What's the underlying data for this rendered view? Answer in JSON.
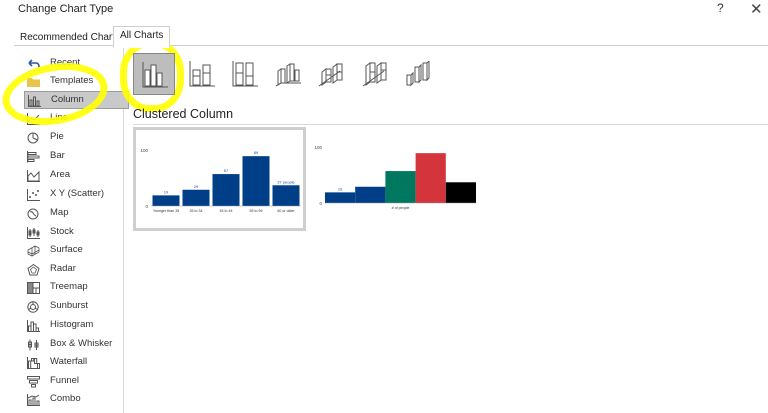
{
  "window": {
    "title": "Change Chart Type",
    "help_label": "?",
    "close_label": "✕"
  },
  "tabs": [
    {
      "label": "Recommended Charts",
      "selected": false
    },
    {
      "label": "All Charts",
      "selected": true
    }
  ],
  "sidebar": {
    "items": [
      {
        "label": "Recent",
        "icon": "undo-arrow-icon"
      },
      {
        "label": "Templates",
        "icon": "folder-icon"
      },
      {
        "label": "Column",
        "icon": "column-chart-icon",
        "selected": true
      },
      {
        "label": "Line",
        "icon": "line-chart-icon"
      },
      {
        "label": "Pie",
        "icon": "pie-chart-icon"
      },
      {
        "label": "Bar",
        "icon": "bar-chart-icon"
      },
      {
        "label": "Area",
        "icon": "area-chart-icon"
      },
      {
        "label": "X Y (Scatter)",
        "icon": "scatter-chart-icon"
      },
      {
        "label": "Map",
        "icon": "map-icon"
      },
      {
        "label": "Stock",
        "icon": "stock-chart-icon"
      },
      {
        "label": "Surface",
        "icon": "surface-chart-icon"
      },
      {
        "label": "Radar",
        "icon": "radar-chart-icon"
      },
      {
        "label": "Treemap",
        "icon": "treemap-icon"
      },
      {
        "label": "Sunburst",
        "icon": "sunburst-icon"
      },
      {
        "label": "Histogram",
        "icon": "histogram-icon"
      },
      {
        "label": "Box & Whisker",
        "icon": "box-whisker-icon"
      },
      {
        "label": "Waterfall",
        "icon": "waterfall-icon"
      },
      {
        "label": "Funnel",
        "icon": "funnel-icon"
      },
      {
        "label": "Combo",
        "icon": "combo-chart-icon"
      }
    ]
  },
  "subtypes": [
    {
      "name": "clustered-column",
      "icon": "clustered-column-icon",
      "selected": true
    },
    {
      "name": "stacked-column",
      "icon": "stacked-column-icon"
    },
    {
      "name": "100-stacked-column",
      "icon": "100-stacked-column-icon"
    },
    {
      "name": "3d-clustered-column",
      "icon": "3d-clustered-column-icon"
    },
    {
      "name": "3d-stacked-column",
      "icon": "3d-stacked-column-icon"
    },
    {
      "name": "3d-100-stacked-column",
      "icon": "3d-100-stacked-column-icon"
    },
    {
      "name": "3d-column",
      "icon": "3d-column-icon"
    }
  ],
  "main": {
    "section_title": "Clustered Column"
  },
  "colors": {
    "bar_blue": "#003f87",
    "teal": "#007860",
    "red": "#d4343c",
    "black": "#000000",
    "highlight": "#ffff00"
  },
  "chart_data": [
    {
      "type": "bar",
      "categories": [
        "Younger than 35",
        "35 to 34",
        "45 to 44",
        "55 to 59",
        "60 or older"
      ],
      "values": [
        19,
        29,
        57,
        89,
        37
      ],
      "data_labels": [
        "19",
        "29",
        "57",
        "89",
        "37 people"
      ],
      "ylim": [
        0,
        100
      ],
      "ytick_labels": [
        "100",
        "0"
      ]
    },
    {
      "type": "bar",
      "categories": [
        "# of people"
      ],
      "series": [
        {
          "values": [
            19
          ]
        },
        {
          "values": [
            29
          ]
        },
        {
          "values": [
            57
          ]
        },
        {
          "values": [
            89
          ]
        },
        {
          "values": [
            37
          ]
        }
      ],
      "series_colors": [
        "#003f87",
        "#003f87",
        "#007860",
        "#d4343c",
        "#000000"
      ],
      "data_labels": [
        "19"
      ],
      "ylim": [
        0,
        100
      ],
      "ytick_labels": [
        "100",
        "0"
      ]
    }
  ]
}
